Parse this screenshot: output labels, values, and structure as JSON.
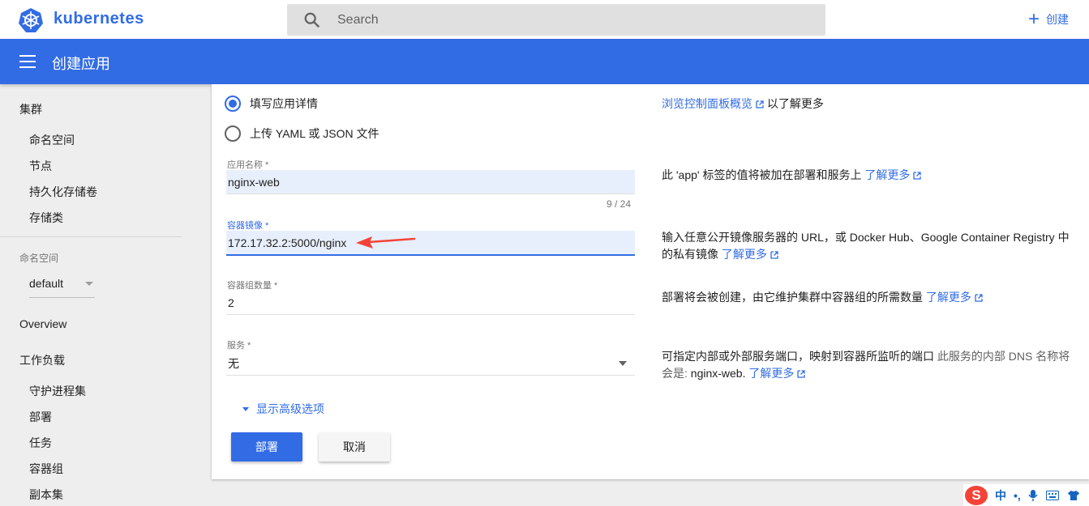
{
  "app": {
    "brand": "kubernetes",
    "page_title": "创建应用"
  },
  "header": {
    "search_placeholder": "Search",
    "create_label": "创建"
  },
  "sidebar": {
    "cluster_heading": "集群",
    "cluster_items": [
      "命名空间",
      "节点",
      "持久化存储卷",
      "存储类"
    ],
    "namespace_label": "命名空间",
    "namespace_value": "default",
    "overview": "Overview",
    "workloads_heading": "工作负载",
    "workload_items": [
      "守护进程集",
      "部署",
      "任务",
      "容器组",
      "副本集"
    ]
  },
  "form": {
    "mode_options": [
      "填写应用详情",
      "上传 YAML 或 JSON 文件"
    ],
    "selected_mode": "填写应用详情",
    "app_name": {
      "label": "应用名称 *",
      "value": "nginx-web",
      "counter": "9 / 24"
    },
    "image": {
      "label": "容器镜像 *",
      "value": "172.17.32.2:5000/nginx"
    },
    "pods": {
      "label": "容器组数量 *",
      "value": "2"
    },
    "service": {
      "label": "服务 *",
      "value": "无"
    },
    "advanced": "显示高级选项",
    "deploy_button": "部署",
    "cancel_button": "取消"
  },
  "help": {
    "overview_link": "浏览控制面板概览",
    "overview_suffix": "以了解更多",
    "app_label_text": "此 'app' 标签的值将被加在部署和服务上",
    "image_text": "输入任意公开镜像服务器的 URL，或 Docker Hub、Google Container Registry 中的私有镜像",
    "pods_text": "部署将会被创建，由它维护集群中容器组的所需数量",
    "service_text": "可指定内部或外部服务端口，映射到容器所监听的端口",
    "service_muted": "此服务的内部 DNS 名称将会是: ",
    "service_dns": "nginx-web.",
    "learn_more": "了解更多"
  },
  "ime": {
    "logo": "S",
    "lang": "中",
    "punct": "•,"
  },
  "colors": {
    "primary": "#326ce5",
    "background": "#eeeeee",
    "arrow": "#f44336"
  }
}
